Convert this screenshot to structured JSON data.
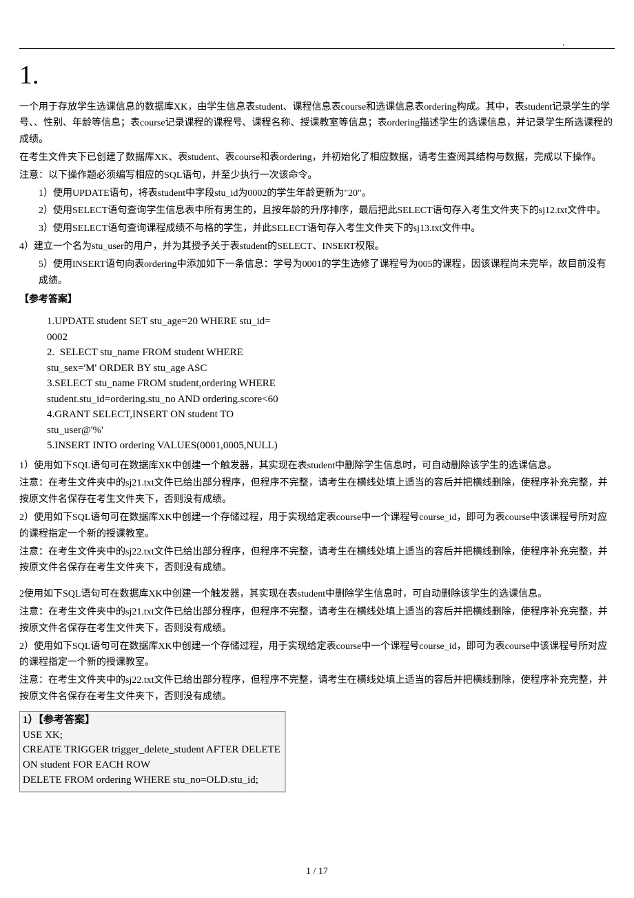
{
  "header_mark": "·",
  "section_number": "1.",
  "paras": {
    "p1": "一个用于存放学生选课信息的数据库XK，由学生信息表student、课程信息表course和选课信息表ordering构成。其中，表student记录学生的学号、、性别、年龄等信息；表course记录课程的课程号、课程名称、授课教室等信息；表ordering描述学生的选课信息，并记录学生所选课程的成绩。",
    "p2": "在考生文件夹下已创建了数据库XK、表student、表course和表ordering，并初始化了相应数据，请考生查阅其结构与数据，完成以下操作。",
    "p3": "注意：以下操作题必须编写相应的SQL语句，并至少执行一次该命令。",
    "q1": "1）使用UPDATE语句，将表student中字段stu_id为0002的学生年龄更新为\"20\"。",
    "q2": "2）使用SELECT语句查询学生信息表中所有男生的，且按年龄的升序排序，最后把此SELECT语句存入考生文件夹下的sj12.txt文件中。",
    "q3": "3）使用SELECT语句查询课程成绩不与格的学生，并此SELECT语句存入考生文件夹下的sj13.txt文件中。",
    "q4": "4）建立一个名为stu_user的用户，并为其授予关于表student的SELECT、INSERT权限。",
    "q5": "5）使用INSERT语句向表ordering中添加如下一条信息：学号为0001的学生选修了课程号为005的课程，因该课程尚未完毕，故目前没有成绩。",
    "ans_label": "【参考答案】",
    "code1": "1.UPDATE student SET stu_age=20 WHERE stu_id=\n0002\n2.  SELECT stu_name FROM student WHERE\nstu_sex='M' ORDER BY stu_age ASC\n3.SELECT stu_name FROM student,ordering WHERE\nstudent.stu_id=ordering.stu_no AND ordering.score<60\n4.GRANT SELECT,INSERT ON student TO\nstu_user@'%'\n5.INSERT INTO ordering VALUES(0001,0005,NULL)",
    "b1": "1）使用如下SQL语句可在数据库XK中创建一个触发器，其实现在表student中删除学生信息时，可自动删除该学生的选课信息。",
    "b2": "注意：在考生文件夹中的sj21.txt文件已给出部分程序，但程序不完整，请考生在横线处填上适当的容后并把横线删除，使程序补充完整，并按原文件名保存在考生文件夹下，否则没有成绩。",
    "b3": " 2）使用如下SQL语句可在数据库XK中创建一个存储过程，用于实现给定表course中一个课程号course_id，即可为表course中该课程号所对应的课程指定一个新的授课教室。",
    "b4": "注意：在考生文件夹中的sj22.txt文件已给出部分程序，但程序不完整，请考生在横线处填上适当的容后并把横线删除，使程序补充完整，并按原文件名保存在考生文件夹下，否则没有成绩。",
    "c1": "2使用如下SQL语句可在数据库XK中创建一个触发器，其实现在表student中删除学生信息时，可自动删除该学生的选课信息。",
    "c2": "注意：在考生文件夹中的sj21.txt文件已给出部分程序，但程序不完整，请考生在横线处填上适当的容后并把横线删除，使程序补充完整，并按原文件名保存在考生文件夹下，否则没有成绩。",
    "c3": "    2）使用如下SQL语句可在数据库XK中创建一个存储过程，用于实现给定表course中一个课程号course_id，即可为表course中该课程号所对应的课程指定一个新的授课教室。",
    "c4": "注意：在考生文件夹中的sj22.txt文件已给出部分程序，但程序不完整，请考生在横线处填上适当的容后并把横线删除，使程序补充完整，并按原文件名保存在考生文件夹下，否则没有成绩。",
    "box_head": "1）【参考答案】",
    "box_body": "USE XK;\nCREATE TRIGGER trigger_delete_student AFTER DELETE\nON student FOR EACH ROW\nDELETE FROM ordering WHERE stu_no=OLD.stu_id;"
  },
  "page_number": "1 / 17"
}
